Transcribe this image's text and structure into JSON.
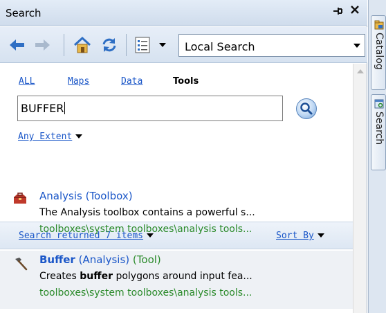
{
  "window": {
    "title": "Search",
    "pin_glyph": "⊣",
    "close_glyph": "✕"
  },
  "toolbar": {
    "back": "back-arrow-icon",
    "forward": "forward-arrow-icon",
    "home": "home-icon",
    "refresh": "refresh-icon",
    "view": "view-options-icon",
    "scope": {
      "selected": "Local Search"
    }
  },
  "filters": {
    "tabs": [
      {
        "label": "ALL",
        "active": false
      },
      {
        "label": "Maps",
        "active": false
      },
      {
        "label": "Data",
        "active": false
      },
      {
        "label": "Tools",
        "active": true
      }
    ],
    "query": "BUFFER",
    "extent": "Any Extent"
  },
  "results": {
    "summary": "Search returned 7 items",
    "sort_label": "Sort By",
    "items": [
      {
        "name": "Analysis",
        "type": "(Toolbox)",
        "kind": "",
        "icon": "toolbox-icon",
        "description_pre": "The Analysis toolbox contains a powerful s...",
        "description_bold": "",
        "description_post": "",
        "path": "toolboxes\\system toolboxes\\analysis tools..."
      },
      {
        "name": "Buffer",
        "type": "(Analysis)",
        "kind": "(Tool)",
        "icon": "hammer-icon",
        "description_pre": "Creates ",
        "description_bold": "buffer",
        "description_post": " polygons around input fea...",
        "path": "toolboxes\\system toolboxes\\analysis tools..."
      }
    ]
  },
  "side_tabs": [
    {
      "label": "Catalog",
      "icon": "catalog-icon"
    },
    {
      "label": "Search",
      "icon": "search-window-icon"
    }
  ],
  "colors": {
    "link": "#1a56c8",
    "path": "#2a8a2a",
    "accent": "#3a6fb5"
  }
}
